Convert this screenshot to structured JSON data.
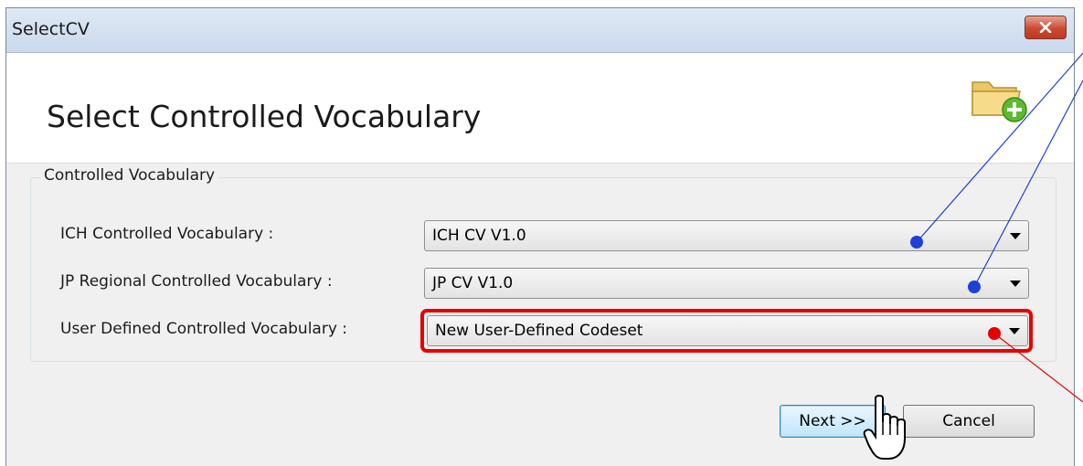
{
  "window": {
    "title": "SelectCV"
  },
  "header": {
    "heading": "Select Controlled Vocabulary",
    "icon": "folder-add-icon"
  },
  "group": {
    "legend": "Controlled Vocabulary",
    "rows": [
      {
        "label": "ICH Controlled Vocabulary :",
        "value": "ICH CV V1.0"
      },
      {
        "label": "JP Regional Controlled Vocabulary :",
        "value": "JP CV V1.0"
      },
      {
        "label": "User Defined Controlled Vocabulary :",
        "value": "New User-Defined Codeset"
      }
    ]
  },
  "buttons": {
    "next": "Next >>",
    "cancel": "Cancel"
  },
  "colors": {
    "highlight": "#e60000",
    "pointer_blue": "#1f3fd9",
    "pointer_red": "#e60000"
  }
}
